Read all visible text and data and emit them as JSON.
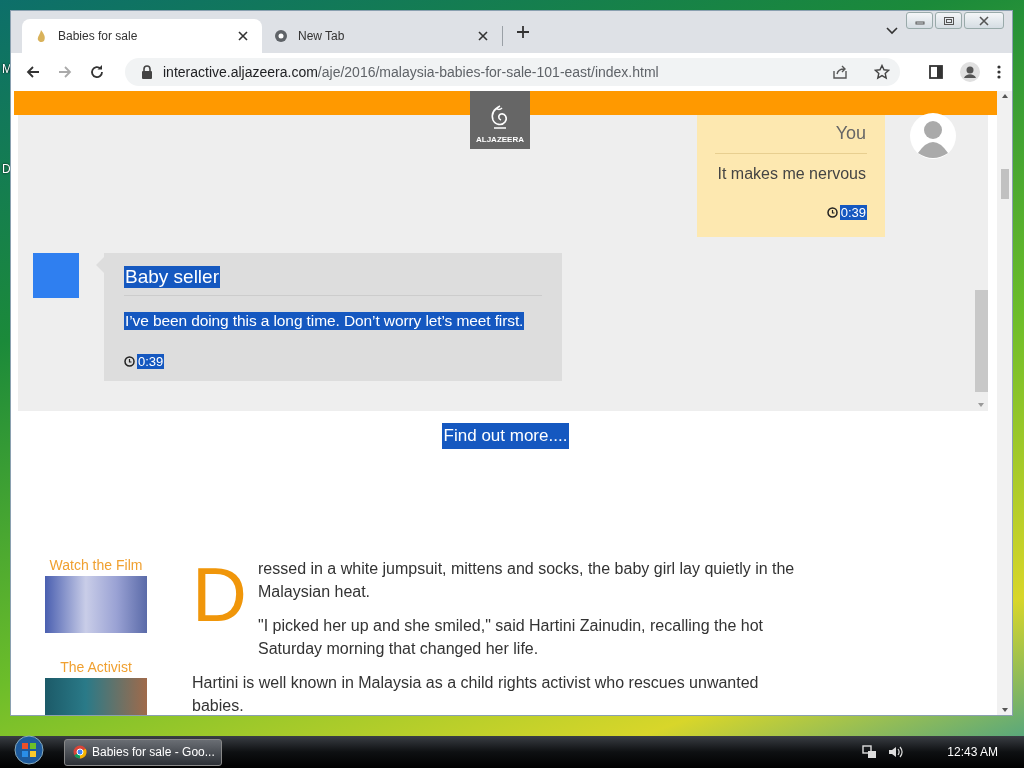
{
  "desktop": {
    "icon_labels": [
      "M",
      "D"
    ]
  },
  "browser": {
    "tabs": [
      {
        "title": "Babies for sale",
        "selected": true
      },
      {
        "title": "New Tab",
        "selected": false
      }
    ],
    "url_host": "interactive.aljazeera.com",
    "url_path": "/aje/2016/malaysia-babies-for-sale-101-east/index.html"
  },
  "logo": {
    "text": "ALJAZEERA"
  },
  "chat": {
    "messages": [
      {
        "kind": "outgoing",
        "sender": "You",
        "text": "It makes me nervous",
        "time": "0:39",
        "sender_highlighted": false,
        "text_highlighted": false,
        "time_highlighted": true
      },
      {
        "kind": "incoming",
        "sender": "Baby seller",
        "text": "I’ve been doing this a long time. Don’t worry let’s meet first.",
        "time": "0:39",
        "sender_highlighted": true,
        "text_highlighted": true,
        "time_highlighted": true
      }
    ]
  },
  "find_more": {
    "label": "Find out more....",
    "highlighted": true
  },
  "sidebar": [
    {
      "title": "Watch the Film"
    },
    {
      "title": "The Activist"
    }
  ],
  "article": {
    "drop_cap": "D",
    "paragraphs": [
      "ressed in a white jumpsuit, mittens and socks, the baby girl lay quietly in the Malaysian heat.",
      "\"I picked her up and she smiled,\" said Hartini Zainudin, recalling the hot Saturday morning that changed her life.",
      "Hartini is well known in Malaysia as a child rights activist who rescues unwanted babies."
    ]
  },
  "taskbar": {
    "button": "Babies for sale - Goo...",
    "clock": "12:43 AM"
  }
}
